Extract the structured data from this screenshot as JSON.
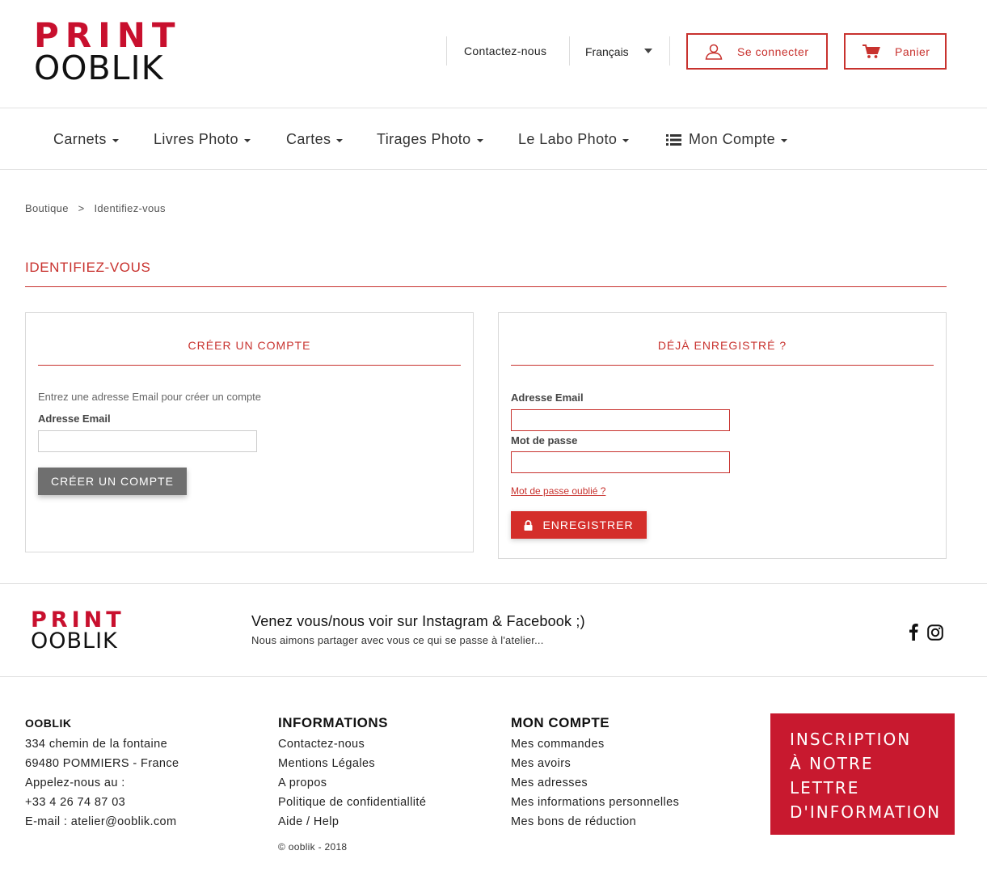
{
  "header": {
    "logo_line1": "PRINT",
    "logo_line2": "OOBLIK",
    "contact_link": "Contactez-nous",
    "language": "Français",
    "login_label": "Se connecter",
    "cart_label": "Panier"
  },
  "nav": {
    "items": [
      {
        "label": "Carnets"
      },
      {
        "label": "Livres Photo"
      },
      {
        "label": "Cartes"
      },
      {
        "label": "Tirages Photo"
      },
      {
        "label": "Le Labo Photo"
      },
      {
        "label": "Mon Compte"
      }
    ]
  },
  "breadcrumb": {
    "home": "Boutique",
    "separator": ">",
    "current": "Identifiez-vous"
  },
  "page_title": "IDENTIFIEZ-VOUS",
  "create_account": {
    "title": "CRÉER UN COMPTE",
    "hint": "Entrez une adresse Email pour créer un compte",
    "email_label": "Adresse Email",
    "email_value": "",
    "button_label": "CRÉER UN COMPTE"
  },
  "login": {
    "title": "DÉJÀ ENREGISTRÉ ?",
    "email_label": "Adresse Email",
    "email_value": "",
    "password_label": "Mot de passe",
    "password_value": "",
    "forgot_label": "Mot de passe oublié ?",
    "button_label": "ENREGISTRER"
  },
  "social": {
    "logo_line1": "PRINT",
    "logo_line2": "OOBLIK",
    "title": "Venez vous/nous voir sur Instagram & Facebook ;)",
    "subtitle": "Nous aimons partager avec vous ce qui se passe à l'atelier..."
  },
  "footer": {
    "company": {
      "name": "OOBLIK",
      "lines": [
        "334 chemin de la fontaine",
        "69480 POMMIERS - France",
        "Appelez-nous au :",
        "+33 4 26 74 87 03",
        "E-mail : atelier@ooblik.com"
      ]
    },
    "informations": {
      "title": "INFORMATIONS",
      "links": [
        "Contactez-nous",
        "Mentions Légales",
        "A propos",
        "Politique de confidentiallité",
        "Aide / Help"
      ]
    },
    "account": {
      "title": "MON COMPTE",
      "links": [
        "Mes commandes",
        "Mes avoirs",
        "Mes adresses",
        "Mes informations personnelles",
        "Mes bons de réduction"
      ]
    },
    "copyright": "© ooblik - 2018",
    "newsletter": [
      "INSCRIPTION",
      "À NOTRE",
      "LETTRE",
      "D'INFORMATION"
    ]
  },
  "colors": {
    "brand_red": "#c8102e",
    "accent_red": "#c8322e",
    "button_red": "#d42e2a",
    "button_grey": "#6f6f6f"
  }
}
